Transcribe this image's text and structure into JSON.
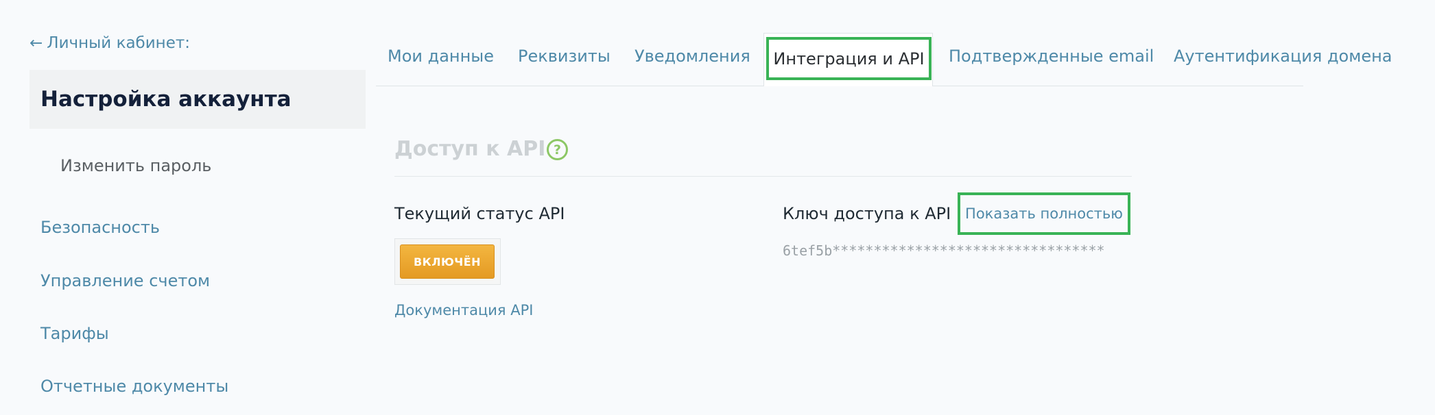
{
  "sidebar": {
    "back_link": "Личный кабинет:",
    "active_section": "Настройка аккаунта",
    "sub_item": "Изменить пароль",
    "items": [
      {
        "label": "Безопасность"
      },
      {
        "label": "Управление счетом"
      },
      {
        "label": "Тарифы"
      },
      {
        "label": "Отчетные документы"
      }
    ]
  },
  "tabs": [
    {
      "label": "Мои данные",
      "active": false
    },
    {
      "label": "Реквизиты",
      "active": false
    },
    {
      "label": "Уведомления",
      "active": false
    },
    {
      "label": "Интеграция и API",
      "active": true
    },
    {
      "label": "Подтвержденные email",
      "active": false
    },
    {
      "label": "Аутентификация домена",
      "active": false
    }
  ],
  "api_section": {
    "title": "Доступ к API",
    "help_icon": "question-circle-icon",
    "status_label": "Текущий статус API",
    "status_button": "ВКЛЮЧЁН",
    "docs_link": "Документация API",
    "key_label": "Ключ доступа к API",
    "show_full_link": "Показать полностью",
    "key_value": "6tef5b*********************************"
  },
  "colors": {
    "link": "#4e89a8",
    "highlight": "#39b356",
    "status_button": "#e9a22c",
    "help_icon": "#8cc765",
    "background": "#f8fafc"
  }
}
